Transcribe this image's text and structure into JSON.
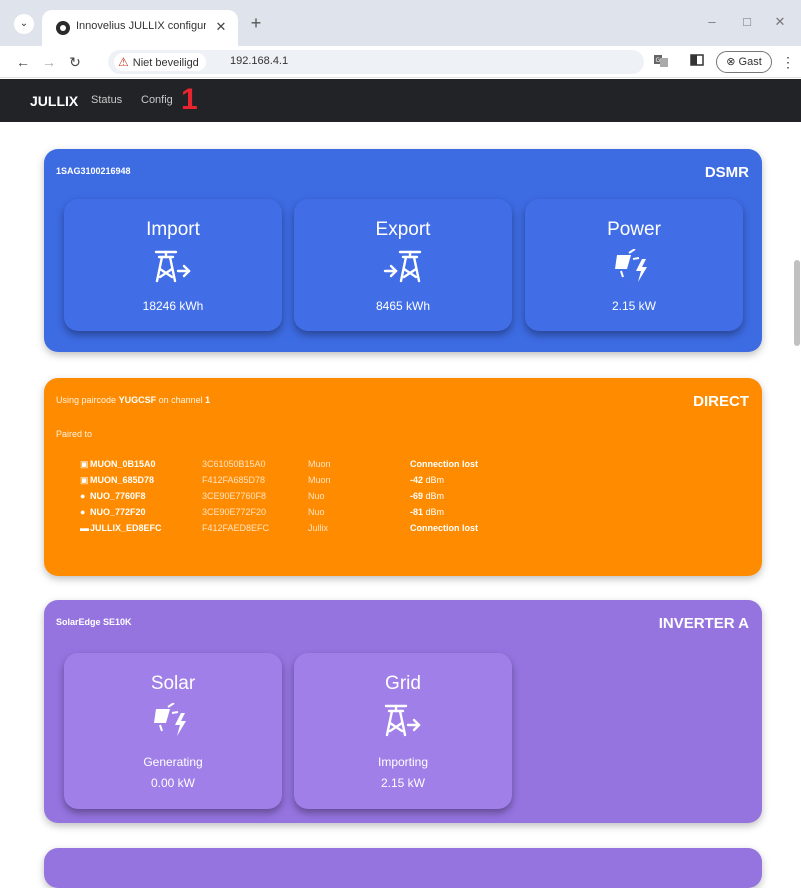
{
  "browser": {
    "tab_title": "Innovelius JULLIX configuration",
    "tab_close": "✕",
    "new_tab": "+",
    "security_label": "Niet beveiligd",
    "url": "192.168.4.1",
    "guest_label": "Gast",
    "win_minimize": "–",
    "win_maximize": "□",
    "win_close": "✕"
  },
  "nav": {
    "brand": "JULLIX",
    "status_label": "Status",
    "config_label": "Config",
    "marker": "1"
  },
  "dsmr": {
    "id": "1SAG3100216948",
    "title": "DSMR",
    "tiles": [
      {
        "label": "Import",
        "icon": "pylon-import-icon",
        "value": "18246 kWh"
      },
      {
        "label": "Export",
        "icon": "pylon-export-icon",
        "value": "8465 kWh"
      },
      {
        "label": "Power",
        "icon": "solar-power-icon",
        "value": "2.15 kW"
      }
    ]
  },
  "direct": {
    "title": "DIRECT",
    "line_prefix": "Using paircode",
    "paircode": "YUGCSF",
    "line_middle": "on channel",
    "channel": "1",
    "paired_label": "Paired to",
    "devices": [
      {
        "icon": "plug-icon",
        "name": "MUON_0B15A0",
        "mac": "3C61050B15A0",
        "type": "Muon",
        "signal": "Connection lost",
        "signal_unit": ""
      },
      {
        "icon": "plug-icon",
        "name": "MUON_685D78",
        "mac": "F412FA685D78",
        "type": "Muon",
        "signal": "-42",
        "signal_unit": "dBm"
      },
      {
        "icon": "bulb-icon",
        "name": "NUO_7760F8",
        "mac": "3CE90E7760F8",
        "type": "Nuo",
        "signal": "-69",
        "signal_unit": "dBm"
      },
      {
        "icon": "bulb-icon",
        "name": "NUO_772F20",
        "mac": "3CE90E772F20",
        "type": "Nuo",
        "signal": "-81",
        "signal_unit": "dBm"
      },
      {
        "icon": "hub-icon",
        "name": "JULLIX_ED8EFC",
        "mac": "F412FAED8EFC",
        "type": "Jullix",
        "signal": "Connection lost",
        "signal_unit": ""
      }
    ]
  },
  "inverter": {
    "id": "SolarEdge SE10K",
    "title": "INVERTER A",
    "tiles": [
      {
        "label": "Solar",
        "icon": "solar-power-icon",
        "status": "Generating",
        "value": "0.00 kW"
      },
      {
        "label": "Grid",
        "icon": "pylon-import-icon",
        "status": "Importing",
        "value": "2.15 kW"
      }
    ]
  },
  "colors": {
    "dsmr": "#3d6be2",
    "direct": "#ff8c00",
    "inverter": "#9574e0",
    "navbar": "#222326",
    "marker": "#e8252e"
  }
}
